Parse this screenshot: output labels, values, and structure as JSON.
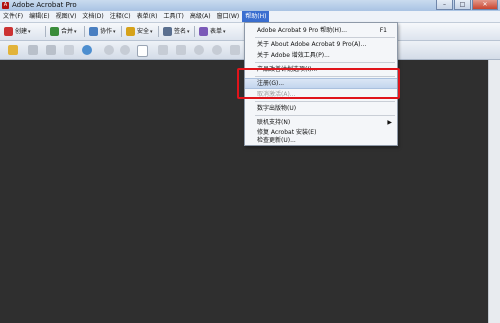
{
  "window": {
    "title": "Adobe Acrobat Pro",
    "minimize": "–",
    "maximize": "□",
    "close": "✕"
  },
  "menubar": [
    "文件(F)",
    "编辑(E)",
    "视图(V)",
    "文档(D)",
    "注释(C)",
    "表单(R)",
    "工具(T)",
    "高级(A)",
    "窗口(W)",
    "帮助(H)"
  ],
  "toolbar": {
    "create": "创建",
    "combine": "合并",
    "collaborate": "协作",
    "secure": "安全",
    "sign": "签名",
    "forms": "表单"
  },
  "help_menu": {
    "items": [
      {
        "label": "Adobe Acrobat 9 Pro 帮助(H)...",
        "shortcut": "F1"
      },
      {
        "label": "关于 About Adobe Acrobat 9 Pro(A)..."
      },
      {
        "label": "关于 Adobe 增效工具(P)..."
      },
      {
        "label": "产品改善计划选项(I)..."
      },
      {
        "label": "注册(G)..."
      },
      {
        "label": "取消激活(A)..."
      },
      {
        "label": "数字出版物(U)"
      },
      {
        "label": "联机支持(N)"
      },
      {
        "label": "修复 Acrobat 安装(E)"
      },
      {
        "label": "检查更新(U)..."
      }
    ],
    "submenu_arrow": "▶"
  },
  "colors": {
    "menu_active": "#3a6ed0",
    "document_bg": "#2f2f2f",
    "highlight_box": "#e0141b"
  }
}
